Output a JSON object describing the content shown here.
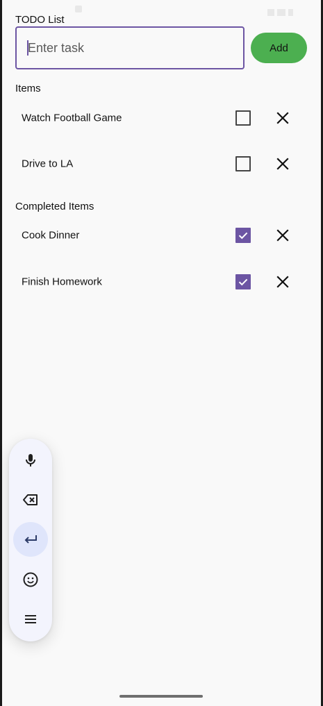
{
  "header": {
    "title": "TODO List"
  },
  "input": {
    "placeholder": "Enter task",
    "value": ""
  },
  "add_button": {
    "label": "Add",
    "color": "#4caf50"
  },
  "accent_color": "#6c55a3",
  "sections": {
    "items": {
      "title": "Items",
      "tasks": [
        {
          "label": "Watch Football Game",
          "completed": false
        },
        {
          "label": "Drive to LA",
          "completed": false
        }
      ]
    },
    "completed": {
      "title": "Completed Items",
      "tasks": [
        {
          "label": "Cook Dinner",
          "completed": true
        },
        {
          "label": "Finish Homework",
          "completed": true
        }
      ]
    }
  },
  "voice_toolbar": {
    "buttons": [
      "microphone-icon",
      "backspace-icon",
      "enter-icon",
      "emoji-icon",
      "menu-icon"
    ],
    "active": "enter-icon"
  }
}
